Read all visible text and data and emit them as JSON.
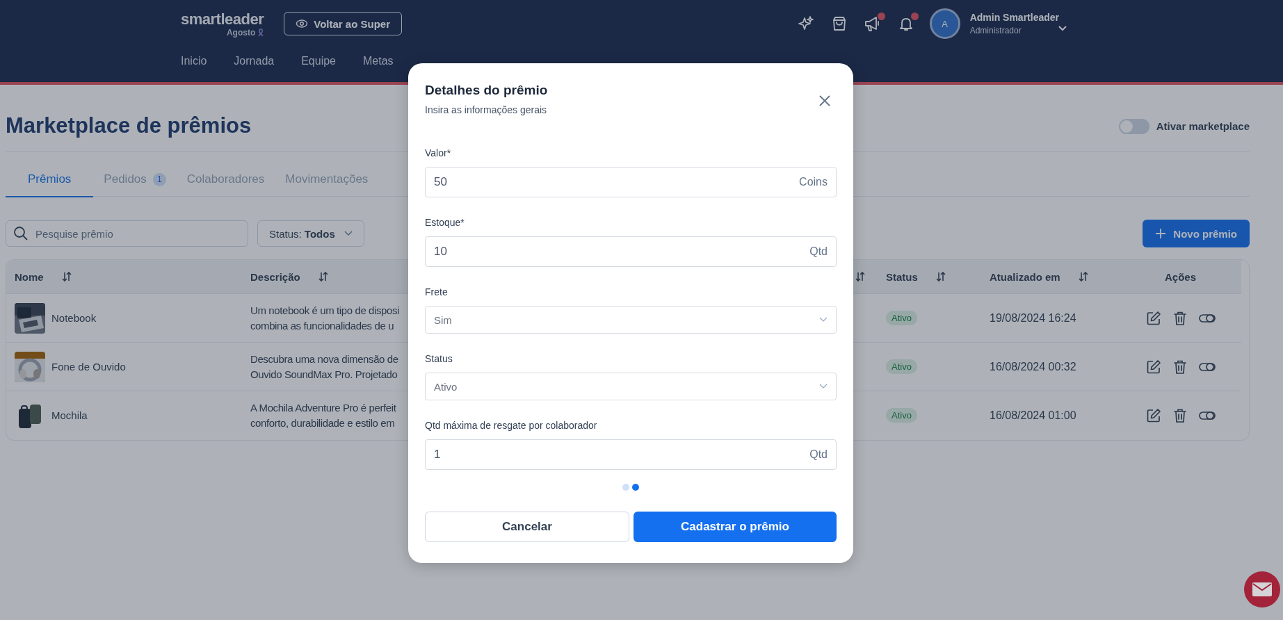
{
  "header": {
    "logo": "smartleader",
    "logo_sub": "Agosto",
    "back_button": "Voltar ao Super",
    "icons": [
      {
        "kind": "sparkle",
        "badge": false
      },
      {
        "kind": "bag",
        "badge": false
      },
      {
        "kind": "megaphone",
        "badge": true
      },
      {
        "kind": "bell",
        "badge": true
      }
    ],
    "user": {
      "initial": "A",
      "name": "Admin Smartleader",
      "role": "Administrador"
    },
    "nav": [
      "Inicio",
      "Jornada",
      "Equipe",
      "Metas"
    ]
  },
  "page": {
    "title": "Marketplace de prêmios",
    "toggle": {
      "label": "Ativar marketplace",
      "on": false
    },
    "tabs": [
      {
        "label": "Prêmios",
        "selected": true
      },
      {
        "label": "Pedidos",
        "badge": "1",
        "selected": false
      },
      {
        "label": "Colaboradores",
        "selected": false
      },
      {
        "label": "Movimentações",
        "selected": false
      }
    ],
    "search": {
      "placeholder": "Pesquise prêmio"
    },
    "status_filter": {
      "label": "Status:",
      "value": "Todos"
    },
    "new_button": "Novo prêmio"
  },
  "table": {
    "columns": [
      {
        "label": "Nome",
        "sortable": true
      },
      {
        "label": "Descrição",
        "sortable": true
      },
      {
        "sortable": true
      },
      {
        "label": "Status",
        "sortable": true
      },
      {
        "label": "Atualizado em",
        "sortable": true
      },
      {
        "label": "Ações",
        "sortable": false
      }
    ],
    "rows": [
      {
        "name": "Notebook",
        "description": [
          "Um notebook é um tipo de disposi",
          "combina as funcionalidades de u"
        ],
        "status": "Ativo",
        "updated": "19/08/2024 16:24"
      },
      {
        "name": "Fone de Ouvido",
        "description": [
          "Descubra uma nova dimensão de",
          "Ouvido SoundMax Pro. Projetado"
        ],
        "status": "Ativo",
        "updated": "16/08/2024 00:32"
      },
      {
        "name": "Mochila",
        "description": [
          "A Mochila Adventure Pro é perfeit",
          "conforto, durabilidade e estilo em"
        ],
        "status": "Ativo",
        "updated": "16/08/2024 01:00"
      }
    ]
  },
  "modal": {
    "title": "Detalhes do prêmio",
    "subtitle": "Insira as informações gerais",
    "fields": [
      {
        "kind": "input",
        "label": "Valor*",
        "value": "50",
        "suffix": "Coins"
      },
      {
        "kind": "input",
        "label": "Estoque*",
        "value": "10",
        "suffix": "Qtd"
      },
      {
        "kind": "select",
        "label": "Frete",
        "value": "Sim"
      },
      {
        "kind": "select",
        "label": "Status",
        "value": "Ativo"
      },
      {
        "kind": "input",
        "label": "Qtd máxima de resgate por colaborador",
        "value": "1",
        "suffix": "Qtd"
      }
    ],
    "steps": [
      {
        "selected": false
      },
      {
        "selected": true
      }
    ],
    "buttons": [
      {
        "label": "Cancelar",
        "kind": "secondary"
      },
      {
        "label": "Cadastrar o prêmio",
        "kind": "primary"
      }
    ]
  }
}
